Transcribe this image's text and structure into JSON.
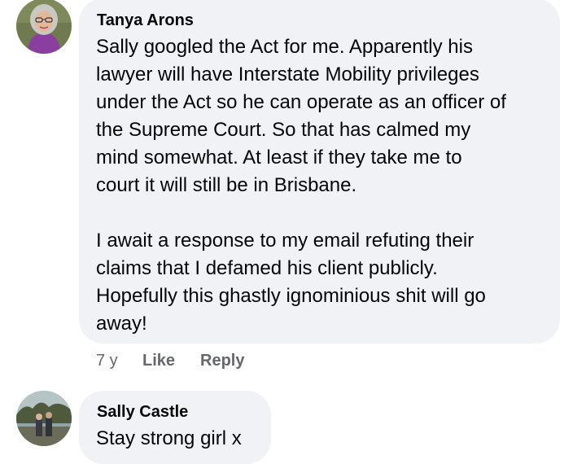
{
  "comments": [
    {
      "author": "Tanya Arons",
      "avatar_icon": "profile-photo-woman-glasses",
      "lines": [
        "Sally googled the Act for me. Apparently his",
        "lawyer will have Interstate Mobility privileges",
        "under the Act so he can operate as an officer of",
        "the Supreme Court.  So that has calmed my",
        "mind somewhat.  At least if they take me to",
        "court it will still be in Brisbane.",
        "",
        "I await a response to my email refuting their",
        "claims that I defamed his client publicly.",
        "Hopefully this ghastly ignominious shit will go",
        "away!"
      ],
      "time": "7 y",
      "like_label": "Like",
      "reply_label": "Reply"
    },
    {
      "author": "Sally Castle",
      "avatar_icon": "profile-photo-outdoor-couple",
      "lines": [
        "Stay strong girl x"
      ]
    }
  ],
  "colors": {
    "bubble": "#f0f2f5",
    "text": "#050505",
    "secondary": "#65676b"
  }
}
